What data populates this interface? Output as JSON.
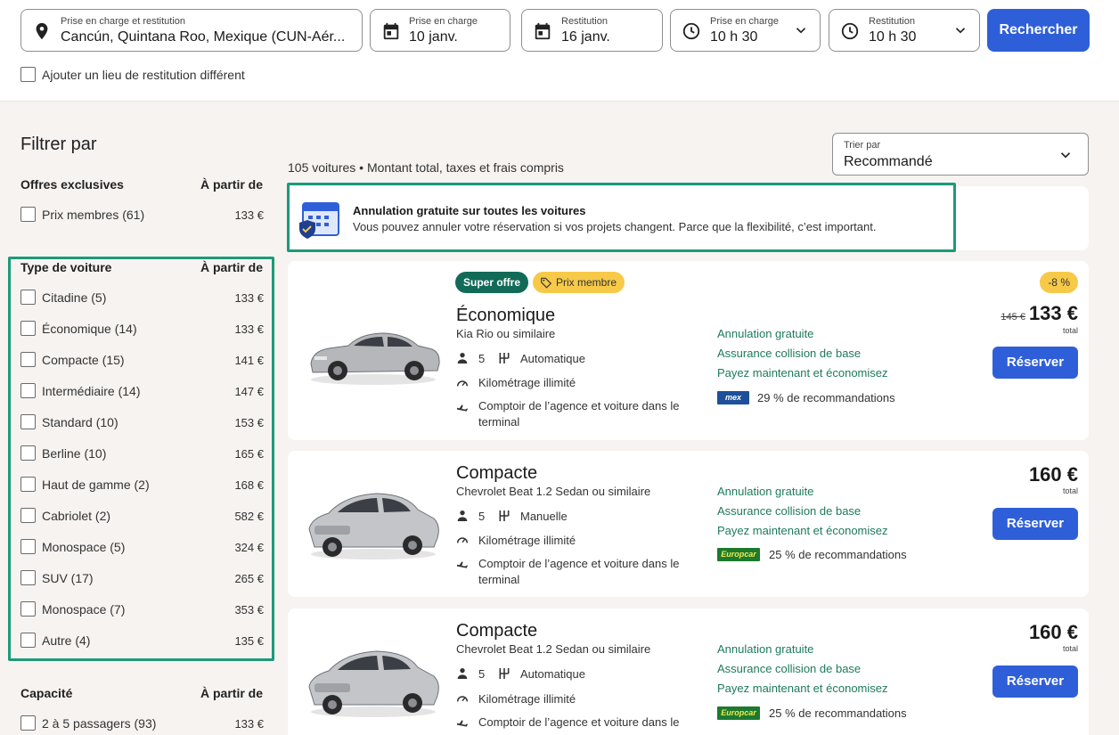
{
  "search": {
    "location": {
      "label": "Prise en charge et restitution",
      "value": "Cancún, Quintana Roo, Mexique (CUN-Aér..."
    },
    "pickup_date": {
      "label": "Prise en charge",
      "value": "10 janv."
    },
    "return_date": {
      "label": "Restitution",
      "value": "16 janv."
    },
    "pickup_time": {
      "label": "Prise en charge",
      "value": "10 h 30"
    },
    "return_time": {
      "label": "Restitution",
      "value": "10 h 30"
    },
    "search_button": "Rechercher",
    "different_return": "Ajouter un lieu de restitution différent"
  },
  "sidebar": {
    "title": "Filtrer par",
    "exclusive": {
      "heading": "Offres exclusives",
      "from": "À partir de",
      "items": [
        {
          "label": "Prix membres (61)",
          "price": "133 €"
        }
      ]
    },
    "car_type": {
      "heading": "Type de voiture",
      "from": "À partir de",
      "items": [
        {
          "label": "Citadine (5)",
          "price": "133 €"
        },
        {
          "label": "Économique (14)",
          "price": "133 €"
        },
        {
          "label": "Compacte (15)",
          "price": "141 €"
        },
        {
          "label": "Intermédiaire (14)",
          "price": "147 €"
        },
        {
          "label": "Standard (10)",
          "price": "153 €"
        },
        {
          "label": "Berline (10)",
          "price": "165 €"
        },
        {
          "label": "Haut de gamme (2)",
          "price": "168 €"
        },
        {
          "label": "Cabriolet (2)",
          "price": "582 €"
        },
        {
          "label": "Monospace (5)",
          "price": "324 €"
        },
        {
          "label": "SUV (17)",
          "price": "265 €"
        },
        {
          "label": "Monospace (7)",
          "price": "353 €"
        },
        {
          "label": "Autre (4)",
          "price": "135 €"
        }
      ]
    },
    "capacity": {
      "heading": "Capacité",
      "from": "À partir de",
      "items": [
        {
          "label": "2 à 5 passagers (93)",
          "price": "133 €"
        }
      ]
    }
  },
  "results": {
    "count": "105 voitures • Montant total, taxes et frais compris",
    "sort": {
      "label": "Trier par",
      "value": "Recommandé"
    },
    "notice": {
      "title": "Annulation gratuite sur toutes les voitures",
      "subtitle": "Vous pouvez annuler votre réservation si vos projets changent. Parce que la flexibilité, c’est important."
    },
    "cards": [
      {
        "badges": {
          "super": "Super offre",
          "member": "Prix membre",
          "discount": "-8 %"
        },
        "category": "Économique",
        "model": "Kia Rio ou similaire",
        "seats": "5",
        "transmission": "Automatique",
        "mileage": "Kilométrage illimité",
        "counter_line1": "Comptoir de l’agence et voiture dans le",
        "counter_line2": "terminal",
        "benefits": [
          "Annulation gratuite",
          "Assurance collision de base",
          "Payez maintenant et économisez"
        ],
        "vendor": "mex",
        "recommendation": "29 % de recommandations",
        "old_price": "145 €",
        "price": "133 €",
        "total": "total",
        "reserve": "Réserver"
      },
      {
        "category": "Compacte",
        "model": "Chevrolet Beat 1.2 Sedan ou similaire",
        "seats": "5",
        "transmission": "Manuelle",
        "mileage": "Kilométrage illimité",
        "counter_line1": "Comptoir de l’agence et voiture dans le",
        "counter_line2": "terminal",
        "benefits": [
          "Annulation gratuite",
          "Assurance collision de base",
          "Payez maintenant et économisez"
        ],
        "vendor": "Europcar",
        "recommendation": "25 % de recommandations",
        "price": "160 €",
        "total": "total",
        "reserve": "Réserver"
      },
      {
        "category": "Compacte",
        "model": "Chevrolet Beat 1.2 Sedan ou similaire",
        "seats": "5",
        "transmission": "Automatique",
        "mileage": "Kilométrage illimité",
        "counter_line1": "Comptoir de l’agence et voiture dans le",
        "benefits": [
          "Annulation gratuite",
          "Assurance collision de base",
          "Payez maintenant et économisez"
        ],
        "vendor": "Europcar",
        "recommendation": "25 % de recommandations",
        "price": "160 €",
        "total": "total",
        "reserve": "Réserver"
      }
    ]
  },
  "colors": {
    "accent": "#2f5fd8",
    "highlight": "#1b9a79",
    "benefit": "#1e7a5c",
    "badge_super": "#126b58",
    "badge_yellow": "#f7c948"
  }
}
